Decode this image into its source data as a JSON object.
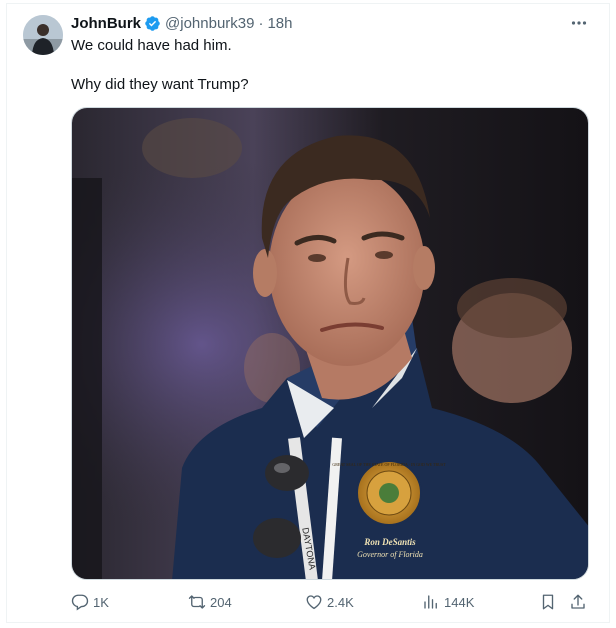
{
  "tweet": {
    "author_name": "JohnBurk",
    "author_handle": "@johnburk39",
    "separator": "·",
    "time": "18h",
    "line1": "We could have had him.",
    "line2": "Why did they want Trump?"
  },
  "media": {
    "seal_name": "Ron DeSantis",
    "seal_title": "Governor of Florida",
    "seal_ring_text": "GREAT SEAL OF THE STATE OF FLORIDA · IN GOD WE TRUST",
    "lanyard_text": "DAYTONA"
  },
  "actions": {
    "replies": "1K",
    "reposts": "204",
    "likes": "2.4K",
    "views": "144K"
  },
  "colors": {
    "verified": "#1d9bf0",
    "muted": "#536471",
    "jacket": "#1b2d4f"
  },
  "icons": {
    "more": "more-dots-icon",
    "verified": "verified-badge-icon",
    "reply": "reply-icon",
    "repost": "repost-icon",
    "like": "heart-icon",
    "views": "views-bar-icon",
    "bookmark": "bookmark-icon",
    "share": "share-icon"
  }
}
